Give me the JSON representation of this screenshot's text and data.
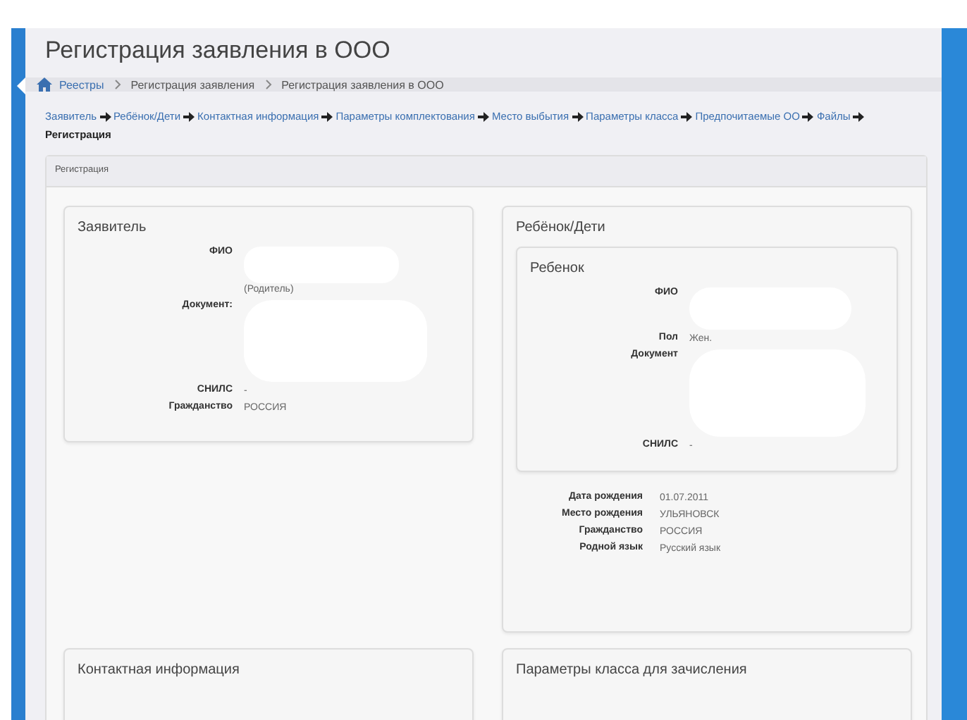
{
  "page": {
    "title": "Регистрация заявления в ООО"
  },
  "breadcrumb": [
    {
      "label": "Реестры",
      "link": true
    },
    {
      "label": "Регистрация заявления",
      "link": false
    },
    {
      "label": "Регистрация заявления в ООО",
      "link": false
    }
  ],
  "steps": [
    {
      "label": "Заявитель",
      "selected": false
    },
    {
      "label": "Ребёнок/Дети",
      "selected": false
    },
    {
      "label": "Контактная информация",
      "selected": false
    },
    {
      "label": "Параметры комплектования",
      "selected": false
    },
    {
      "label": "Место выбытия",
      "selected": false
    },
    {
      "label": "Параметры класса",
      "selected": false
    },
    {
      "label": "Предпочитаемые ОО",
      "selected": false
    },
    {
      "label": "Файлы",
      "selected": false
    },
    {
      "label": "Регистрация",
      "selected": true
    }
  ],
  "panel": {
    "title": "Регистрация"
  },
  "applicant": {
    "title": "Заявитель",
    "fields": [
      {
        "label": "ФИО",
        "value": "(Родитель)",
        "redacted": true
      },
      {
        "label": "Документ:",
        "redacted": true
      },
      {
        "label": "СНИЛС",
        "value": "-",
        "redacted": false
      },
      {
        "label": "Гражданство",
        "value": "РОССИЯ",
        "redacted": false
      }
    ]
  },
  "children": {
    "title": "Ребёнок/Дети",
    "child": {
      "title": "Ребенок",
      "fields": [
        {
          "label": "ФИО",
          "redacted": true
        },
        {
          "label": "Пол",
          "value": "Жен.",
          "redacted": false
        },
        {
          "label": "Документ",
          "redacted": true
        },
        {
          "label": "СНИЛС",
          "value": "-",
          "redacted": false
        }
      ]
    },
    "fields": [
      {
        "label": "Дата рождения",
        "value": "01.07.2011",
        "redacted": false
      },
      {
        "label": "Место рождения",
        "value": "УЛЬЯНОВСК",
        "redacted": false
      },
      {
        "label": "Гражданство",
        "value": "РОССИЯ",
        "redacted": false
      },
      {
        "label": "Родной язык",
        "value": "Русский язык",
        "redacted": false
      }
    ]
  },
  "bottom_cards": [
    {
      "title": "Контактная информация"
    },
    {
      "title": "Параметры класса для зачисления"
    }
  ]
}
